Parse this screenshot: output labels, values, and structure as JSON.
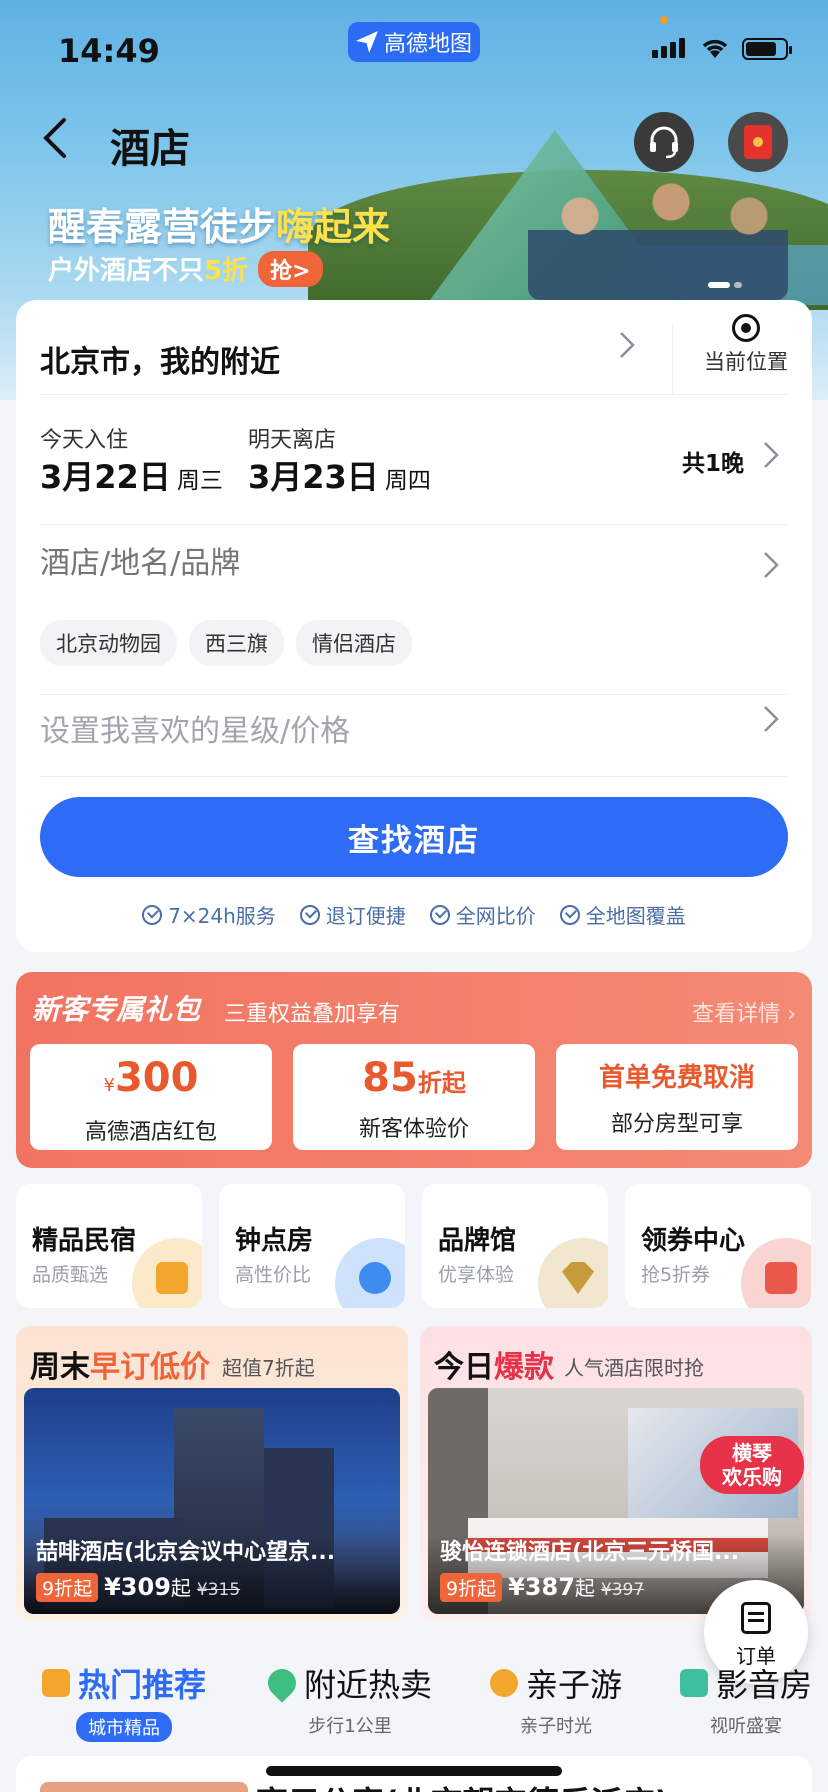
{
  "status": {
    "time": "14:49",
    "app_name": "高德地图"
  },
  "header": {
    "title": "酒店"
  },
  "banner": {
    "headline_pre": "醒春露营徒步",
    "headline_hl": "嗨起来",
    "sub_pre": "户外酒店不只",
    "sub_hl": "5折",
    "grab_label": "抢>"
  },
  "search": {
    "location": "北京市，我的附近",
    "current_location_label": "当前位置",
    "checkin_label": "今天入住",
    "checkin_date": "3月22日",
    "checkin_weekday": "周三",
    "checkout_label": "明天离店",
    "checkout_date": "3月23日",
    "checkout_weekday": "周四",
    "nights": "共1晚",
    "keyword_placeholder": "酒店/地名/品牌",
    "tags": [
      "北京动物园",
      "西三旗",
      "情侣酒店"
    ],
    "star_price_placeholder": "设置我喜欢的星级/价格",
    "find_button": "查找酒店",
    "features": [
      "7×24h服务",
      "退订便捷",
      "全网比价",
      "全地图覆盖"
    ]
  },
  "new_customer": {
    "title": "新客专属礼包",
    "subtitle": "三重权益叠加享有",
    "more": "查看详情",
    "coupons": [
      {
        "yen": "¥",
        "big": "300",
        "suffix": "",
        "desc": "高德酒店红包"
      },
      {
        "yen": "",
        "big": "85",
        "suffix": "折起",
        "desc": "新客体验价"
      },
      {
        "yen": "",
        "big": "首单免费取消",
        "suffix": "",
        "desc": "部分房型可享"
      }
    ]
  },
  "categories": [
    {
      "name": "精品民宿",
      "sub": "品质甄选",
      "icon": "house-icon",
      "color": "#f2a72c"
    },
    {
      "name": "钟点房",
      "sub": "高性价比",
      "icon": "clock-icon",
      "color": "#3e8cf0"
    },
    {
      "name": "品牌馆",
      "sub": "优享体验",
      "icon": "v-badge-icon",
      "color": "#c79a3a"
    },
    {
      "name": "领券中心",
      "sub": "抢5折券",
      "icon": "coupon-icon",
      "color": "#e9584a"
    }
  ],
  "deals": [
    {
      "title_pre": "周末",
      "title_hl": "早订低价",
      "subtitle": "超值7折起",
      "hotel": "喆啡酒店(北京会议中心望京...",
      "discount": "9折起",
      "price": "¥309",
      "price_suffix": "起",
      "original": "¥315"
    },
    {
      "title_pre": "今日",
      "title_hl": "爆款",
      "subtitle": "人气酒店限时抢",
      "hotel": "骏怡连锁酒店(北京三元桥国...",
      "discount": "9折起",
      "price": "¥387",
      "price_suffix": "起",
      "original": "¥397",
      "badge_line1": "横琴",
      "badge_line2": "欢乐购"
    }
  ],
  "order_button": "订单",
  "tabs": [
    {
      "label": "热门推荐",
      "sub": "城市精品",
      "icon": "thumbs-up-icon"
    },
    {
      "label": "附近热卖",
      "sub": "步行1公里",
      "icon": "location-pin-icon"
    },
    {
      "label": "亲子游",
      "sub": "亲子时光",
      "icon": "family-icon"
    },
    {
      "label": "影音房",
      "sub": "视听盛宴",
      "icon": "video-icon"
    }
  ],
  "bottom_preview_title": "亮元公寓(北京望京德乐派店)",
  "colors": {
    "primary": "#2f6cf6",
    "accent": "#e85a2e",
    "promo_bg": "#f17462"
  }
}
